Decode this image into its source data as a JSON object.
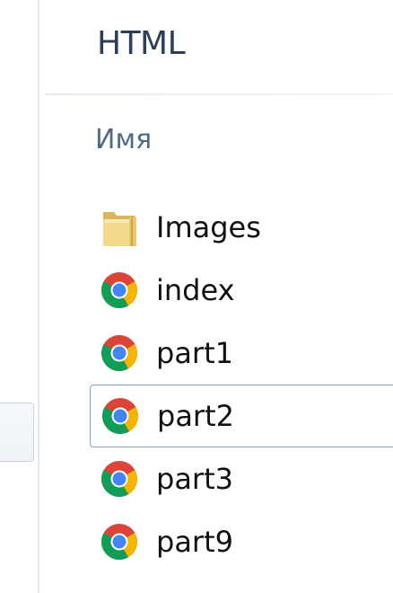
{
  "header": {
    "folder_title": "HTML"
  },
  "columns": {
    "name_label": "Имя"
  },
  "files": [
    {
      "label": "Images",
      "icon": "folder-icon",
      "selected": false
    },
    {
      "label": "index",
      "icon": "chrome-icon",
      "selected": false
    },
    {
      "label": "part1",
      "icon": "chrome-icon",
      "selected": false
    },
    {
      "label": "part2",
      "icon": "chrome-icon",
      "selected": true
    },
    {
      "label": "part3",
      "icon": "chrome-icon",
      "selected": false
    },
    {
      "label": "part9",
      "icon": "chrome-icon",
      "selected": false
    }
  ],
  "colors": {
    "selection_border": "#7da2ce",
    "title_text": "#2b3f57",
    "column_header_text": "#4e6a87"
  }
}
